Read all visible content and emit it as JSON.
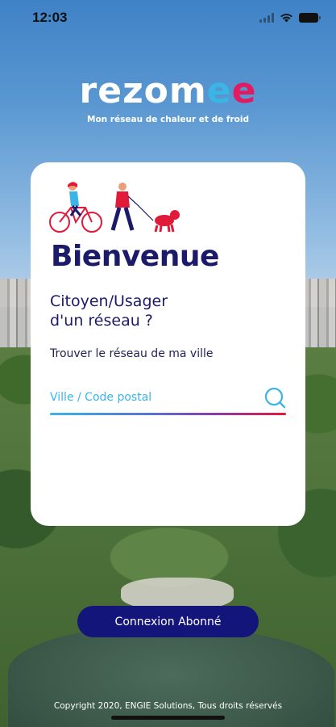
{
  "status_bar": {
    "time": "12:03"
  },
  "logo": {
    "word_main": "rezom",
    "word_accent_1": "e",
    "word_accent_2": "e",
    "tagline": "Mon réseau de chaleur et de froid"
  },
  "card": {
    "title": "Bienvenue",
    "subtitle_line1": "Citoyen/Usager",
    "subtitle_line2": "d'un réseau ?",
    "instruction": "Trouver le réseau de ma ville",
    "search": {
      "placeholder": "Ville / Code postal",
      "value": ""
    }
  },
  "login_button": {
    "label": "Connexion Abonné"
  },
  "footer": {
    "copyright": "Copyright 2020, ENGIE Solutions, Tous droits réservés"
  },
  "colors": {
    "brand_navy": "#1c1a6b",
    "button_navy": "#14157a",
    "accent_blue": "#3bb4e6",
    "accent_red": "#e21a61"
  },
  "icons": [
    "wifi-icon",
    "battery-icon",
    "signal-icon",
    "search-icon",
    "cyclist-illustration",
    "walker-illustration",
    "dog-illustration"
  ]
}
